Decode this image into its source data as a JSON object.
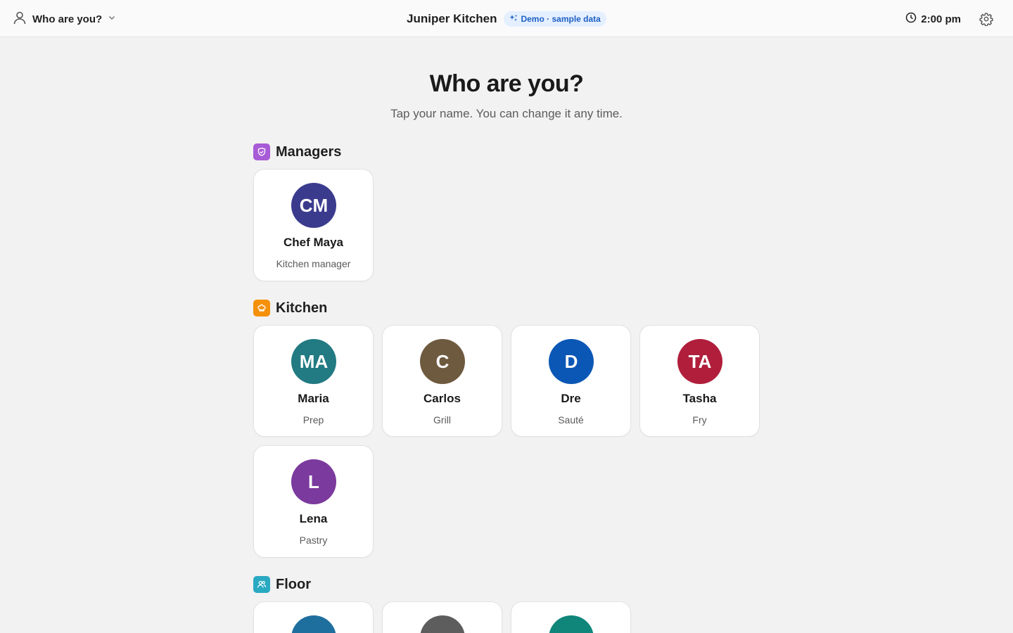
{
  "header": {
    "user_menu_label": "Who are you?",
    "brand": "Juniper Kitchen",
    "demo_badge": "Demo · sample data",
    "time": "2:00 pm"
  },
  "page": {
    "title": "Who are you?",
    "subtitle": "Tap your name. You can change it any time."
  },
  "sections": {
    "managers": {
      "label": "Managers",
      "icon": "shield-icon",
      "color": "#a85bd6"
    },
    "kitchen": {
      "label": "Kitchen",
      "icon": "chef-hat-icon",
      "color": "#f5900b"
    },
    "floor": {
      "label": "Floor",
      "icon": "users-icon",
      "color": "#2aa9c2"
    }
  },
  "people": {
    "chef_maya": {
      "initials": "CM",
      "name": "Chef Maya",
      "role": "Kitchen manager",
      "color": "#3b3b8e"
    },
    "maria": {
      "initials": "MA",
      "name": "Maria",
      "role": "Prep",
      "color": "#227a82"
    },
    "carlos": {
      "initials": "C",
      "name": "Carlos",
      "role": "Grill",
      "color": "#6e5a3f"
    },
    "dre": {
      "initials": "D",
      "name": "Dre",
      "role": "Sauté",
      "color": "#0b57b5"
    },
    "tasha": {
      "initials": "TA",
      "name": "Tasha",
      "role": "Fry",
      "color": "#b01e3c"
    },
    "lena": {
      "initials": "L",
      "name": "Lena",
      "role": "Pastry",
      "color": "#7b3a9e"
    }
  },
  "floor_partial": [
    {
      "color": "#1f6f9e"
    },
    {
      "color": "#5d5d5d"
    },
    {
      "color": "#10867a"
    }
  ]
}
